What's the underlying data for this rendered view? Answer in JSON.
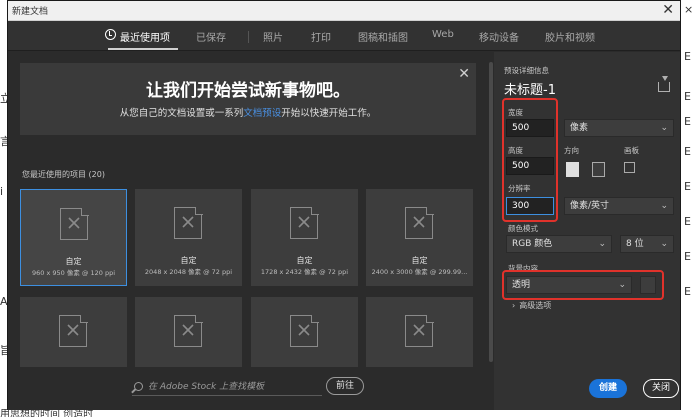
{
  "window": {
    "title": "新建文档",
    "close_glyph": "✕"
  },
  "tabs": [
    {
      "label": "最近使用项",
      "active": true
    },
    {
      "label": "已保存"
    },
    {
      "label": "照片"
    },
    {
      "label": "打印"
    },
    {
      "label": "图稿和插图"
    },
    {
      "label": "Web"
    },
    {
      "label": "移动设备"
    },
    {
      "label": "胶片和视频"
    }
  ],
  "banner": {
    "headline": "让我们开始尝试新事物吧。",
    "sub_before": "从您自己的文档设置或一系列",
    "sub_link": "文档预设",
    "sub_after": "开始以快速开始工作。",
    "close_glyph": "✕"
  },
  "recent": {
    "label": "您最近使用的项目 (20)",
    "items": [
      {
        "name": "自定",
        "meta": "960 x 950 像素 @ 120 ppi"
      },
      {
        "name": "自定",
        "meta": "2048 x 2048 像素 @ 72 ppi"
      },
      {
        "name": "自定",
        "meta": "1728 x 2432 像素 @ 72 ppi"
      },
      {
        "name": "自定",
        "meta": "2400 x 3000 像素 @ 299.99..."
      },
      {
        "name": "",
        "meta": ""
      },
      {
        "name": "",
        "meta": ""
      },
      {
        "name": "",
        "meta": ""
      },
      {
        "name": "",
        "meta": ""
      }
    ]
  },
  "stock": {
    "placeholder": "在 Adobe Stock 上查找模板",
    "go_label": "前往"
  },
  "details": {
    "section_label": "预设详细信息",
    "preset_name": "未标题-1",
    "width_label": "宽度",
    "width_value": "500",
    "width_unit": "像素",
    "height_label": "高度",
    "height_value": "500",
    "orientation_label": "方向",
    "artboard_label": "画板",
    "resolution_label": "分辨率",
    "resolution_value": "300",
    "resolution_unit": "像素/英寸",
    "color_mode_label": "颜色模式",
    "color_mode_value": "RGB 颜色",
    "bit_depth_value": "8 位",
    "background_label": "背景内容",
    "background_value": "透明",
    "advanced_label": "高级选项"
  },
  "buttons": {
    "create": "创建",
    "close": "关闭"
  },
  "background_doc": {
    "left_chars": [
      "立",
      "言",
      "i",
      "A",
      "旨"
    ],
    "right_chars": [
      "×",
      "E",
      "E",
      "E",
      "E",
      "E",
      "E",
      "E",
      "E"
    ],
    "bottom_text": "用思想的时间 创造时"
  },
  "colors": {
    "accent": "#1a73d9",
    "highlight": "#e0322b",
    "dialog_bg": "#2b2b2b"
  }
}
